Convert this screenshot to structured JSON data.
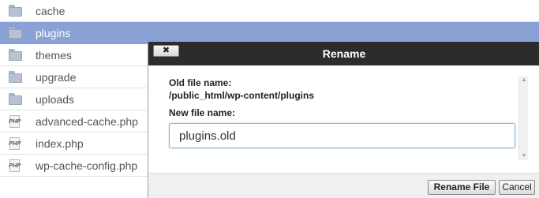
{
  "file_list": {
    "items": [
      {
        "name": "cache",
        "type": "folder",
        "selected": false
      },
      {
        "name": "plugins",
        "type": "folder",
        "selected": true
      },
      {
        "name": "themes",
        "type": "folder",
        "selected": false
      },
      {
        "name": "upgrade",
        "type": "folder",
        "selected": false
      },
      {
        "name": "uploads",
        "type": "folder",
        "selected": false
      },
      {
        "name": "advanced-cache.php",
        "type": "php",
        "selected": false
      },
      {
        "name": "index.php",
        "type": "php",
        "selected": false
      },
      {
        "name": "wp-cache-config.php",
        "type": "php",
        "selected": false
      }
    ],
    "php_icon_text": "PHP"
  },
  "dialog": {
    "title": "Rename",
    "close_label": "✖",
    "old_name_label": "Old file name:",
    "old_name_value": "/public_html/wp-content/plugins",
    "new_name_label": "New file name:",
    "new_name_value": "plugins.old",
    "rename_button": "Rename File",
    "cancel_button": "Cancel"
  },
  "colors": {
    "selected_row": "#8aa1d6",
    "dialog_header": "#2c2c2c"
  }
}
